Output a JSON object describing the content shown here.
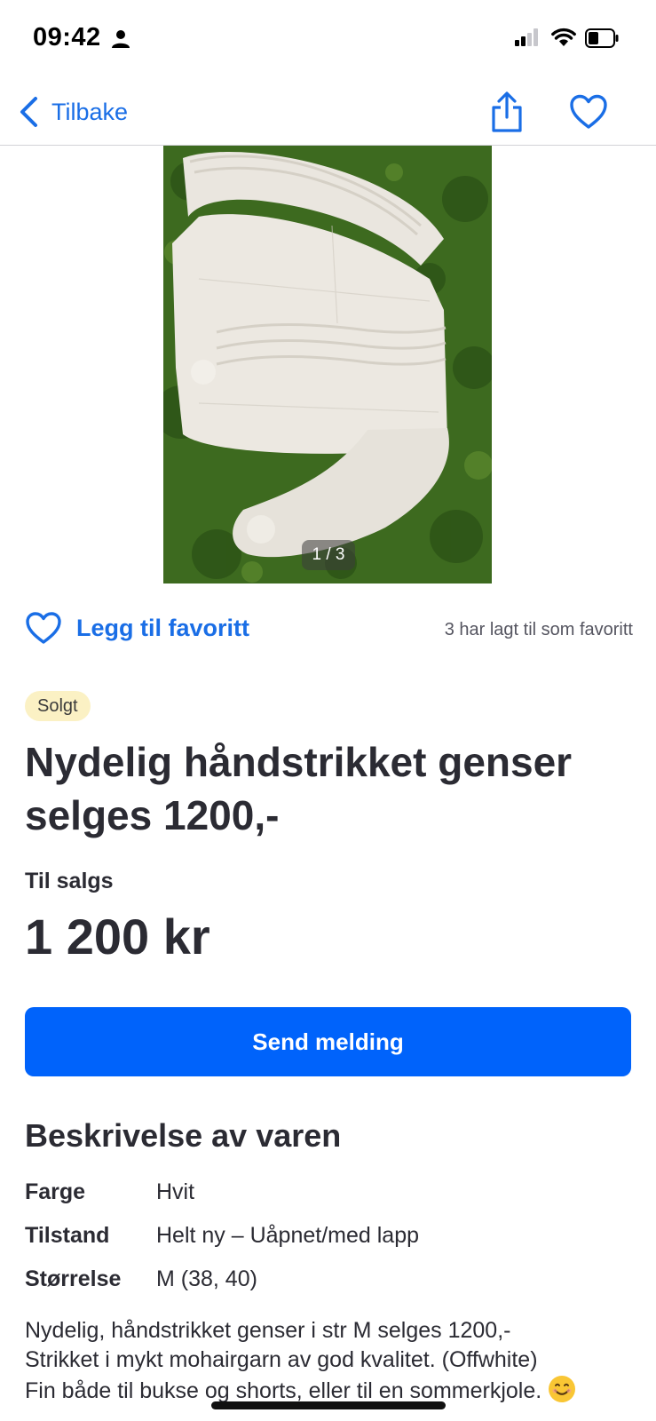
{
  "status_bar": {
    "time": "09:42",
    "icons": [
      "person-icon",
      "signal-icon",
      "wifi-icon",
      "battery-icon"
    ]
  },
  "nav": {
    "back_label": "Tilbake",
    "icons": [
      "chevron-left-icon",
      "share-icon",
      "heart-outline-icon"
    ]
  },
  "gallery": {
    "counter": "1 / 3"
  },
  "favorite": {
    "add_label": "Legg til favoritt",
    "count_text": "3 har lagt til som favoritt"
  },
  "listing": {
    "status_badge": "Solgt",
    "title": "Nydelig håndstrikket genser selges 1200,-",
    "sale_type": "Til salgs",
    "price": "1 200 kr",
    "send_button": "Send melding"
  },
  "description": {
    "heading": "Beskrivelse av varen",
    "attributes": [
      {
        "key": "Farge",
        "value": "Hvit"
      },
      {
        "key": "Tilstand",
        "value": "Helt ny – Uåpnet/med lapp"
      },
      {
        "key": "Størrelse",
        "value": "M (38, 40)"
      }
    ],
    "text": "Nydelig, håndstrikket genser i str M selges 1200,-\nStrikket i mykt mohairgarn av god kvalitet. (Offwhite)\nFin både til bukse og shorts, eller til en sommerkjole."
  },
  "colors": {
    "accent_blue": "#1a6ee6",
    "button_blue": "#0063fb",
    "badge_yellow": "#fbf1c4",
    "text_dark": "#2b2b33"
  }
}
